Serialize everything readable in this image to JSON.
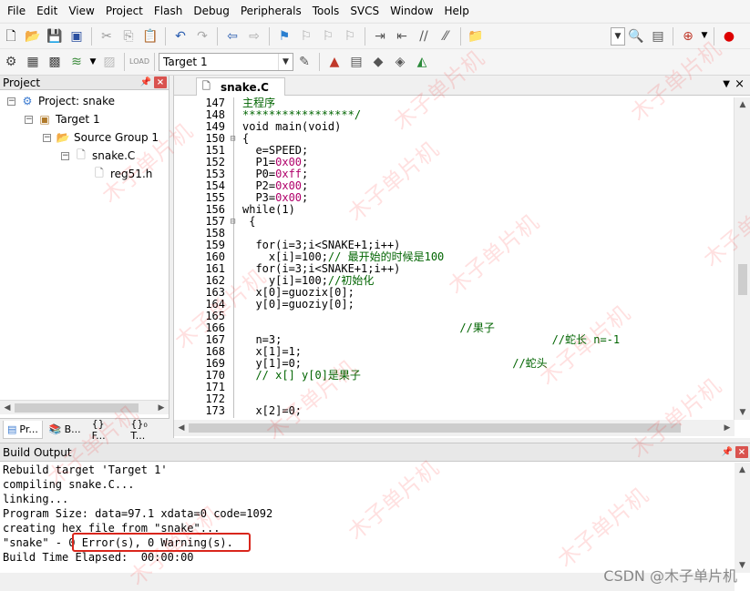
{
  "menu": [
    "File",
    "Edit",
    "View",
    "Project",
    "Flash",
    "Debug",
    "Peripherals",
    "Tools",
    "SVCS",
    "Window",
    "Help"
  ],
  "toolbar": {
    "target_combo": "Target 1"
  },
  "project_panel": {
    "title": "Project",
    "pin_icon": "pin-icon",
    "close_icon": "close-icon",
    "tree": {
      "root": "Project: snake",
      "target": "Target 1",
      "group": "Source Group 1",
      "file": "snake.C",
      "include": "reg51.h"
    },
    "tabs": [
      "Pr...",
      "B...",
      "{} F...",
      "{}₀ T..."
    ]
  },
  "editor": {
    "tab_label": "snake.C",
    "lines": [
      {
        "n": "147",
        "fold": "",
        "text": "主程序",
        "kind": "cmt"
      },
      {
        "n": "148",
        "fold": "",
        "text": "*****************/",
        "kind": "cmt"
      },
      {
        "n": "149",
        "fold": "",
        "text": "void main(void)",
        "kind": "code"
      },
      {
        "n": "150",
        "fold": "⊟",
        "text": "{",
        "kind": "code"
      },
      {
        "n": "151",
        "fold": "",
        "text": "  e=SPEED;",
        "kind": "code"
      },
      {
        "n": "152",
        "fold": "",
        "text": "  P1=",
        "num": "0x00",
        "tail": ";",
        "kind": "mixed"
      },
      {
        "n": "153",
        "fold": "",
        "text": "  P0=",
        "num": "0xff",
        "tail": ";",
        "kind": "mixed"
      },
      {
        "n": "154",
        "fold": "",
        "text": "  P2=",
        "num": "0x00",
        "tail": ";",
        "kind": "mixed"
      },
      {
        "n": "155",
        "fold": "",
        "text": "  P3=",
        "num": "0x00",
        "tail": ";",
        "kind": "mixed"
      },
      {
        "n": "156",
        "fold": "",
        "text": "while(1)",
        "kind": "code"
      },
      {
        "n": "157",
        "fold": "⊟",
        "text": " {",
        "kind": "code"
      },
      {
        "n": "158",
        "fold": "",
        "text": "",
        "kind": "code"
      },
      {
        "n": "159",
        "fold": "",
        "text": "  for(i=3;i<SNAKE+1;i++)",
        "kind": "code"
      },
      {
        "n": "160",
        "fold": "",
        "text": "    x[i]=100;",
        "comment": "// 最开始的时候是100",
        "kind": "codecmt"
      },
      {
        "n": "161",
        "fold": "",
        "text": "  for(i=3;i<SNAKE+1;i++)",
        "kind": "code"
      },
      {
        "n": "162",
        "fold": "",
        "text": "    y[i]=100;",
        "comment": "//初始化",
        "kind": "codecmt"
      },
      {
        "n": "163",
        "fold": "",
        "text": "  x[0]=guozix[0];",
        "kind": "code"
      },
      {
        "n": "164",
        "fold": "",
        "text": "  y[0]=guoziy[0];",
        "kind": "code"
      },
      {
        "n": "165",
        "fold": "",
        "text": "",
        "kind": "code"
      },
      {
        "n": "166",
        "fold": "",
        "text": "                                 ",
        "comment": "//果子",
        "kind": "codecmt"
      },
      {
        "n": "167",
        "fold": "",
        "text": "  n=3;                                         ",
        "comment": "//蛇长 n=-1",
        "kind": "codecmt"
      },
      {
        "n": "168",
        "fold": "",
        "text": "  x[1]=1;",
        "kind": "code"
      },
      {
        "n": "169",
        "fold": "",
        "text": "  y[1]=0;                                ",
        "comment": "//蛇头",
        "kind": "codecmt"
      },
      {
        "n": "170",
        "fold": "",
        "text": "  ",
        "comment": "// x[] y[0]是果子",
        "kind": "codecmt"
      },
      {
        "n": "171",
        "fold": "",
        "text": "",
        "kind": "code"
      },
      {
        "n": "172",
        "fold": "",
        "text": "",
        "kind": "code"
      },
      {
        "n": "173",
        "fold": "",
        "text": "  x[2]=0;",
        "kind": "code"
      }
    ]
  },
  "build_output": {
    "title": "Build Output",
    "lines": [
      "Rebuild target 'Target 1'",
      "compiling snake.C...",
      "linking...",
      "Program Size: data=97.1 xdata=0 code=1092",
      "creating hex file from \"snake\"...",
      "\"snake\" - 0 Error(s), 0 Warning(s).",
      "Build Time Elapsed:  00:00:00"
    ],
    "highlight_color": "#d9261c"
  },
  "watermark": {
    "text": "木子单片机",
    "credit": "CSDN @木子单片机"
  }
}
